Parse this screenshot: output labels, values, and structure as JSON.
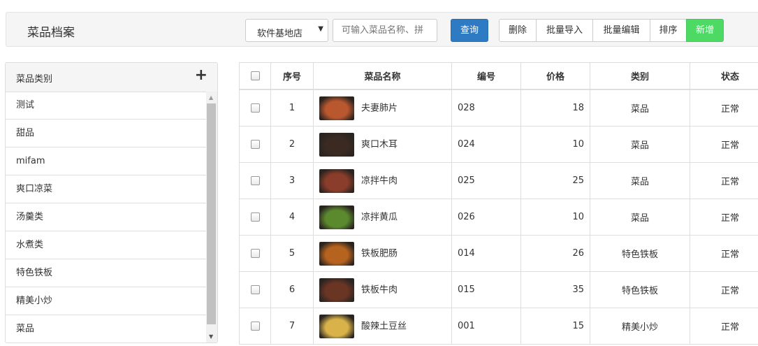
{
  "header": {
    "title": "菜品档案",
    "store_select": "软件基地店",
    "search_placeholder": "可输入菜品名称、拼",
    "btn_query": "查询",
    "btn_delete": "删除",
    "btn_import": "批量导入",
    "btn_batch_edit": "批量编辑",
    "btn_sort": "排序",
    "btn_add": "新增"
  },
  "sidebar": {
    "title": "菜品类别",
    "add_icon": "plus-icon",
    "items": [
      "测试",
      "甜品",
      "mifam",
      "爽口凉菜",
      "汤羹类",
      "水煮类",
      "特色铁板",
      "精美小炒",
      "菜品"
    ]
  },
  "table": {
    "columns": [
      "序号",
      "菜品名称",
      "编号",
      "价格",
      "类别",
      "状态"
    ],
    "rows": [
      {
        "seq": "1",
        "name": "夫妻肺片",
        "code": "028",
        "price": "18",
        "type": "菜品",
        "status": "正常",
        "color": "#b9572f"
      },
      {
        "seq": "2",
        "name": "爽口木耳",
        "code": "024",
        "price": "10",
        "type": "菜品",
        "status": "正常",
        "color": "#3a2a22"
      },
      {
        "seq": "3",
        "name": "凉拌牛肉",
        "code": "025",
        "price": "25",
        "type": "菜品",
        "status": "正常",
        "color": "#8a3d2a"
      },
      {
        "seq": "4",
        "name": "凉拌黄瓜",
        "code": "026",
        "price": "10",
        "type": "菜品",
        "status": "正常",
        "color": "#5b8a2e"
      },
      {
        "seq": "5",
        "name": "铁板肥肠",
        "code": "014",
        "price": "26",
        "type": "特色铁板",
        "status": "正常",
        "color": "#b5631f"
      },
      {
        "seq": "6",
        "name": "铁板牛肉",
        "code": "015",
        "price": "35",
        "type": "特色铁板",
        "status": "正常",
        "color": "#6b3524"
      },
      {
        "seq": "7",
        "name": "酸辣土豆丝",
        "code": "001",
        "price": "15",
        "type": "精美小炒",
        "status": "正常",
        "color": "#d9b34a"
      }
    ]
  }
}
